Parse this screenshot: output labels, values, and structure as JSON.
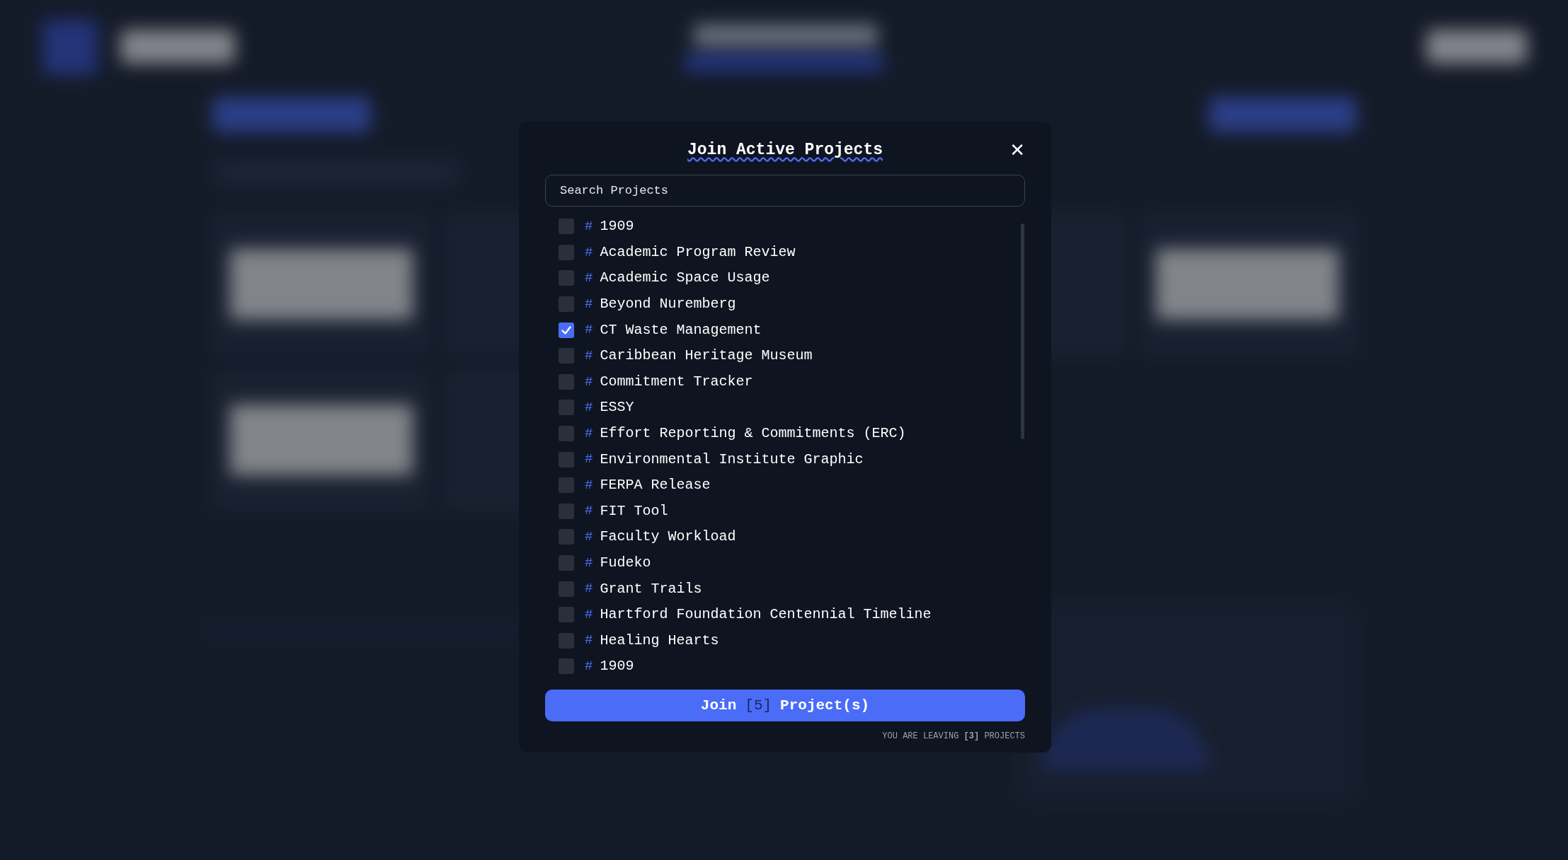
{
  "modal": {
    "title": "Join Active Projects",
    "close": "✕",
    "search": {
      "placeholder": "Search Projects"
    },
    "projects": [
      {
        "hash": "#",
        "name": "1909",
        "checked": false
      },
      {
        "hash": "#",
        "name": "Academic Program Review",
        "checked": false
      },
      {
        "hash": "#",
        "name": "Academic Space Usage",
        "checked": false
      },
      {
        "hash": "#",
        "name": "Beyond Nuremberg",
        "checked": false
      },
      {
        "hash": "#",
        "name": "CT Waste Management",
        "checked": true
      },
      {
        "hash": "#",
        "name": "Caribbean Heritage Museum",
        "checked": false
      },
      {
        "hash": "#",
        "name": "Commitment Tracker",
        "checked": false
      },
      {
        "hash": "#",
        "name": "ESSY",
        "checked": false
      },
      {
        "hash": "#",
        "name": "Effort Reporting & Commitments (ERC)",
        "checked": false
      },
      {
        "hash": "#",
        "name": "Environmental Institute Graphic",
        "checked": false
      },
      {
        "hash": "#",
        "name": "FERPA Release",
        "checked": false
      },
      {
        "hash": "#",
        "name": "FIT Tool",
        "checked": false
      },
      {
        "hash": "#",
        "name": "Faculty Workload",
        "checked": false
      },
      {
        "hash": "#",
        "name": "Fudeko",
        "checked": false
      },
      {
        "hash": "#",
        "name": "Grant Trails",
        "checked": false
      },
      {
        "hash": "#",
        "name": "Hartford Foundation Centennial Timeline",
        "checked": false
      },
      {
        "hash": "#",
        "name": "Healing Hearts",
        "checked": false
      },
      {
        "hash": "#",
        "name": "1909",
        "checked": false
      }
    ],
    "join_button": {
      "verb": "Join",
      "count": "[5]",
      "noun": "Project(s)"
    },
    "footer": "YOU ARE LEAVING **[3]** PROJECTS"
  }
}
